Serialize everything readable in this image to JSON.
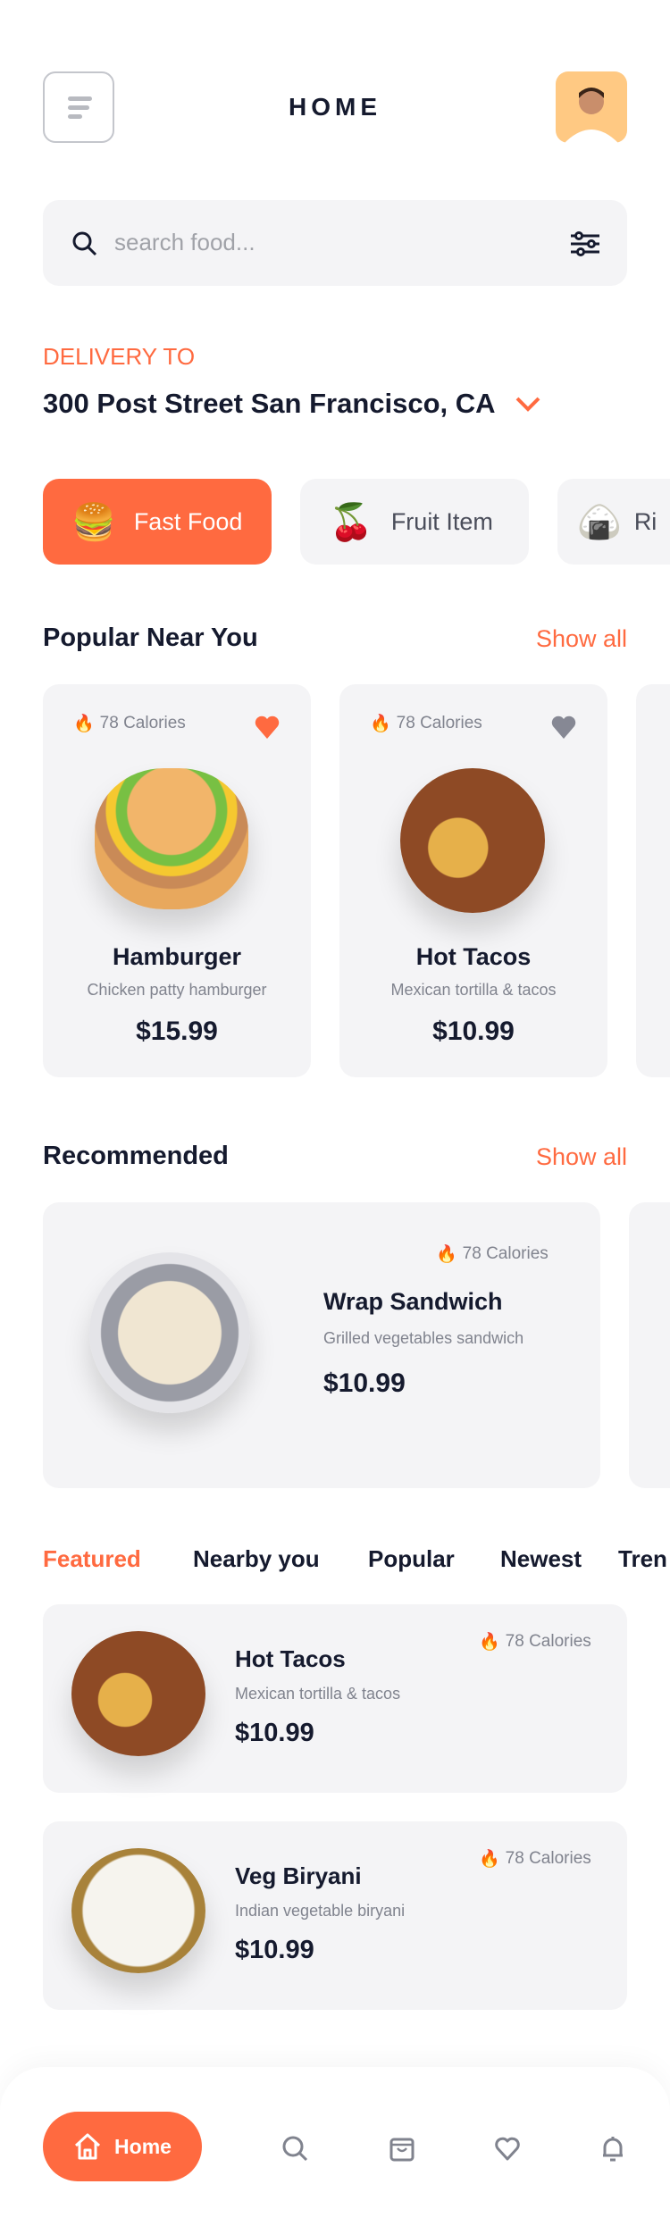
{
  "header": {
    "title": "HOME"
  },
  "search": {
    "placeholder": "search food..."
  },
  "delivery": {
    "label": "DELIVERY TO",
    "address": "300 Post Street San Francisco, CA"
  },
  "categories": [
    {
      "label": "Fast Food",
      "emoji": "🍔",
      "active": true
    },
    {
      "label": "Fruit Item",
      "emoji": "🍒"
    },
    {
      "label": "Ri",
      "emoji": "🍙"
    }
  ],
  "popular": {
    "title": "Popular Near You",
    "show_all": "Show all",
    "items": [
      {
        "calories": "78 Calories",
        "name": "Hamburger",
        "desc": "Chicken patty hamburger",
        "price": "$15.99",
        "favorite": true
      },
      {
        "calories": "78 Calories",
        "name": "Hot Tacos",
        "desc": "Mexican tortilla & tacos",
        "price": "$10.99",
        "favorite": false
      }
    ]
  },
  "recommended": {
    "title": "Recommended",
    "show_all": "Show all",
    "items": [
      {
        "calories": "78 Calories",
        "name": "Wrap Sandwich",
        "desc": "Grilled vegetables sandwich",
        "price": "$10.99"
      }
    ]
  },
  "tabs": [
    "Featured",
    "Nearby you",
    "Popular",
    "Newest",
    "Tren"
  ],
  "list": [
    {
      "calories": "78 Calories",
      "name": "Hot Tacos",
      "desc": "Mexican tortilla & tacos",
      "price": "$10.99"
    },
    {
      "calories": "78 Calories",
      "name": "Veg Biryani",
      "desc": "Indian vegetable biryani",
      "price": "$10.99"
    }
  ],
  "nav": {
    "home": "Home",
    "icons": [
      "search-icon",
      "bag-icon",
      "heart-icon",
      "bell-icon"
    ]
  },
  "colors": {
    "accent": "#ff6a40",
    "card": "#f4f4f6",
    "text": "#151a2e"
  }
}
